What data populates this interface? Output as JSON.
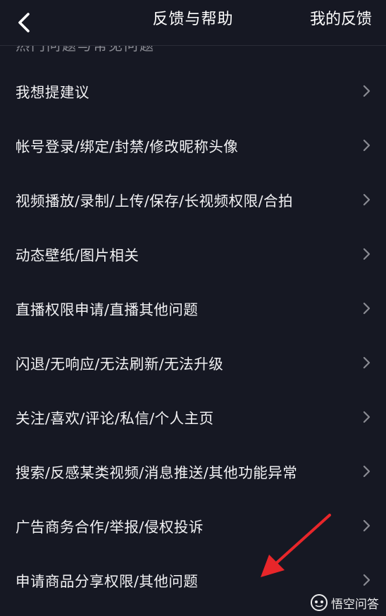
{
  "header": {
    "title": "反馈与帮助",
    "right_action": "我的反馈"
  },
  "cutoff_text": "热门问题与常见问题",
  "items": [
    {
      "label": "我想提建议"
    },
    {
      "label": "帐号登录/绑定/封禁/修改昵称头像"
    },
    {
      "label": "视频播放/录制/上传/保存/长视频权限/合拍"
    },
    {
      "label": "动态壁纸/图片相关"
    },
    {
      "label": "直播权限申请/直播其他问题"
    },
    {
      "label": "闪退/无响应/无法刷新/无法升级"
    },
    {
      "label": "关注/喜欢/评论/私信/个人主页"
    },
    {
      "label": "搜索/反感某类视频/消息推送/其他功能异常"
    },
    {
      "label": "广告商务合作/举报/侵权投诉"
    },
    {
      "label": "申请商品分享权限/其他问题"
    }
  ],
  "watermark": "悟空问答",
  "colors": {
    "background": "#161823",
    "annotation_arrow": "#e8262a",
    "chevron": "#8a8b93"
  },
  "icons": {
    "back": "chevron-left-icon",
    "row": "chevron-right-icon",
    "annotation": "red-arrow-icon",
    "watermark": "wukong-logo-icon"
  }
}
